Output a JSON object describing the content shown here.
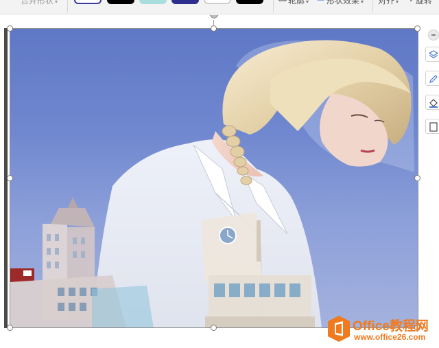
{
  "ribbon": {
    "merge_shape_label": "合并形状",
    "swatches": [
      {
        "fill": "#ffffff",
        "border": "#3a3aa0"
      },
      {
        "fill": "#000000",
        "border": "#000000"
      },
      {
        "fill": "#a9dede",
        "border": "#a9dede"
      },
      {
        "fill": "#2e2e8f",
        "border": "#2e2e8f"
      },
      {
        "fill": "#ffffff",
        "border": "#cfcfcf"
      },
      {
        "fill": "#000000",
        "border": "#000000"
      }
    ],
    "outline_label": "轮廓",
    "shape_effect_label": "形状效果",
    "align_label": "对齐",
    "rotate_label": "旋转"
  },
  "watermark": {
    "title": "Office教程网",
    "url": "www.office26.com",
    "color": "#f07a1f"
  },
  "side_toolbar": {
    "icons": [
      "layers-icon",
      "pen-icon",
      "fill-icon",
      "crop-frame-icon"
    ]
  }
}
